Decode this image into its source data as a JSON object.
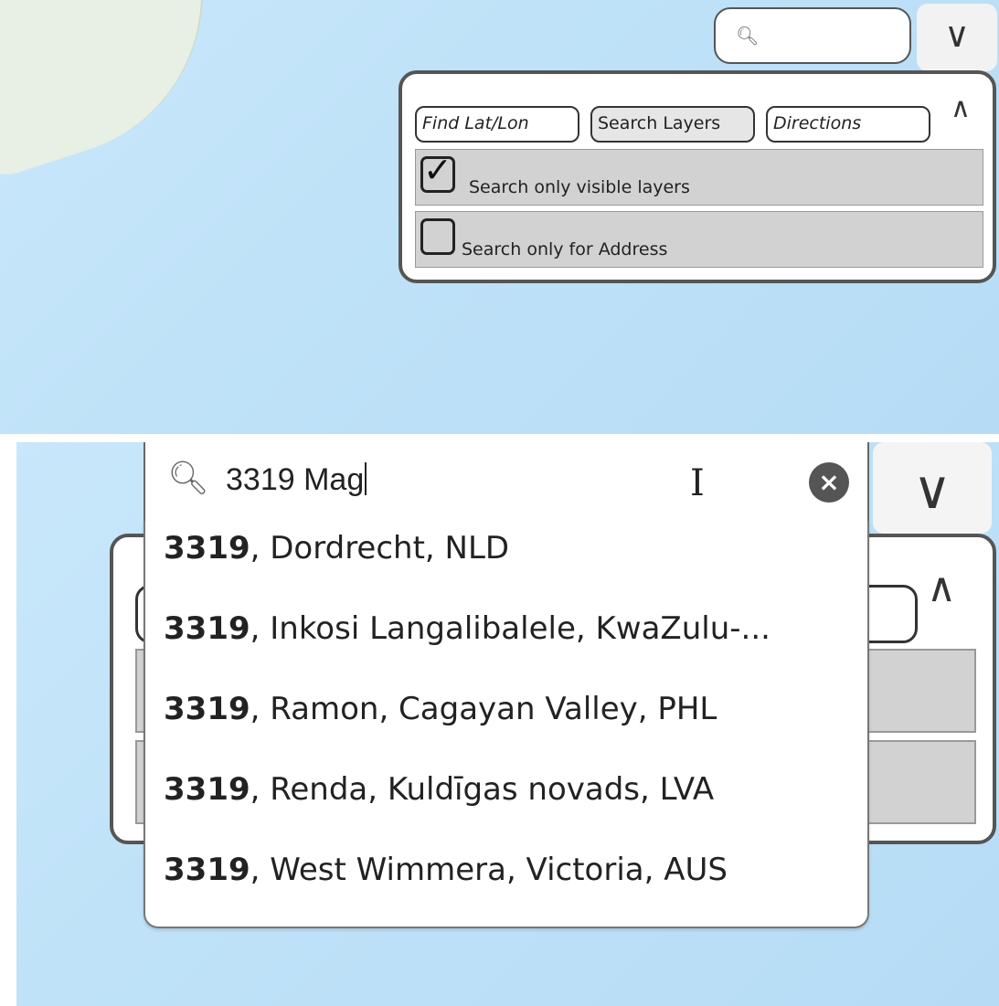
{
  "top_panel": {
    "search_icon": "search-icon",
    "collapse_icon": "double-chevron-down-icon",
    "tabs": [
      {
        "label": "Find Lat/Lon",
        "italic": true,
        "active": false
      },
      {
        "label": "Search Layers",
        "italic": false,
        "active": true
      },
      {
        "label": "Directions",
        "italic": true,
        "active": false
      }
    ],
    "expand_icon": "double-chevron-up-icon",
    "options": [
      {
        "label": "Search only visible layers",
        "checked": true
      },
      {
        "label": "Search only for Address",
        "checked": false
      }
    ]
  },
  "bottom_panel": {
    "search_value": "3319 Mag",
    "search_icon": "search-icon",
    "clear_icon": "clear-icon",
    "collapse_icon": "double-chevron-down-icon",
    "suggestions": [
      {
        "match": "3319",
        "rest": ", Dordrecht, NLD"
      },
      {
        "match": "3319",
        "rest": ", Inkosi Langalibalele, KwaZulu-..."
      },
      {
        "match": "3319",
        "rest": ", Ramon, Cagayan Valley, PHL"
      },
      {
        "match": "3319",
        "rest": ", Renda, Kuldīgas novads, LVA"
      },
      {
        "match": "3319",
        "rest": ", West Wimmera, Victoria, AUS"
      }
    ]
  }
}
